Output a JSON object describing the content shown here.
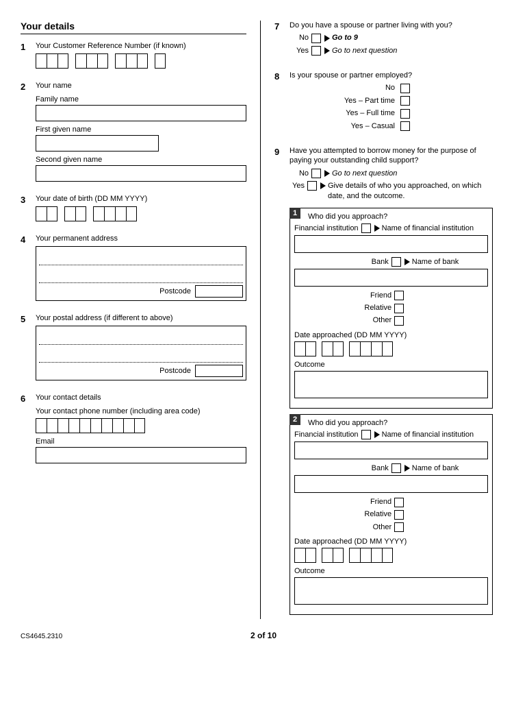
{
  "sectionTitle": "Your details",
  "q1": {
    "num": "1",
    "text": "Your Customer Reference Number (if known)"
  },
  "q2": {
    "num": "2",
    "text": "Your name",
    "family": "Family name",
    "first": "First given name",
    "second": "Second given name"
  },
  "q3": {
    "num": "3",
    "text": "Your date of birth (DD MM YYYY)"
  },
  "q4": {
    "num": "4",
    "text": "Your permanent address",
    "postcode": "Postcode"
  },
  "q5": {
    "num": "5",
    "text": "Your postal address (if different to above)",
    "postcode": "Postcode"
  },
  "q6": {
    "num": "6",
    "text": "Your contact details",
    "phone": "Your contact phone number (including area code)",
    "email": "Email"
  },
  "q7": {
    "num": "7",
    "text": "Do you have a spouse or partner living with you?",
    "no": "No",
    "noGoto": "Go to 9",
    "yes": "Yes",
    "yesGoto": "Go to next question"
  },
  "q8": {
    "num": "8",
    "text": "Is your spouse or partner employed?",
    "opts": [
      "No",
      "Yes – Part time",
      "Yes – Full time",
      "Yes – Casual"
    ]
  },
  "q9": {
    "num": "9",
    "text": "Have you attempted to borrow money for the purpose of paying your outstanding child support?",
    "no": "No",
    "noGoto": "Go to next question",
    "yes": "Yes",
    "yesGoto": "Give details of who you approached, on which date, and the outcome.",
    "sub": {
      "title": "Who did you approach?",
      "fin": "Financial institution",
      "finName": "Name of financial institution",
      "bank": "Bank",
      "bankName": "Name of bank",
      "friend": "Friend",
      "relative": "Relative",
      "other": "Other",
      "date": "Date approached (DD MM YYYY)",
      "outcome": "Outcome"
    },
    "sub1num": "1",
    "sub2num": "2"
  },
  "footer": {
    "code": "CS4645.2310",
    "page": "2 of 10"
  }
}
